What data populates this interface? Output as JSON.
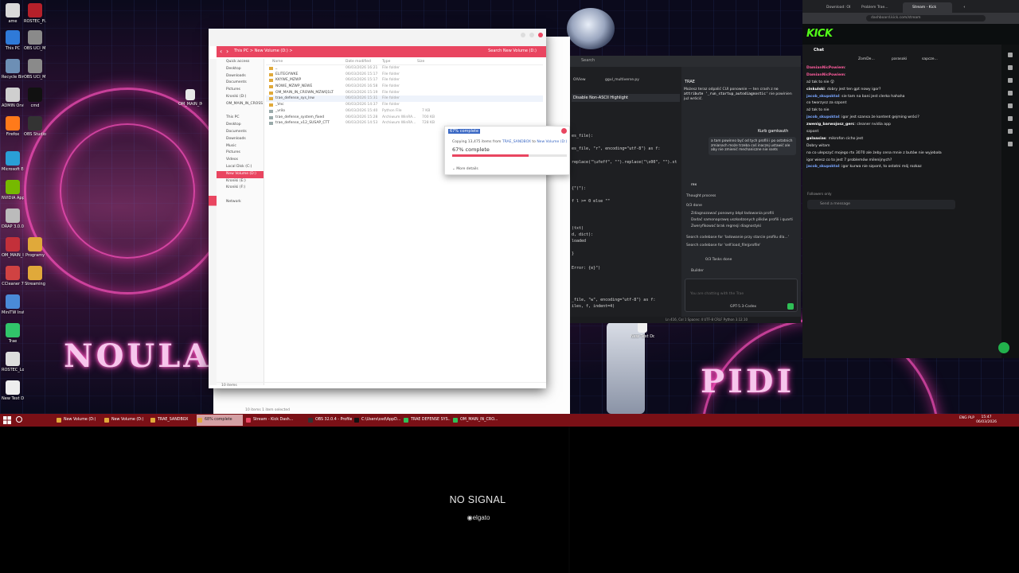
{
  "desktop": {
    "icons": [
      {
        "label": "ame",
        "color": "#d9d9d9"
      },
      {
        "label": "ROSTEC_Fi...",
        "color": "#b5202a"
      },
      {
        "label": "This PC",
        "color": "#2f7ad8"
      },
      {
        "label": "OBS UCI_M...",
        "color": "#8a8a8a"
      },
      {
        "label": "Recycle Bin",
        "color": "#6d8fb5"
      },
      {
        "label": "OBS UCI_M...",
        "color": "#8a8a8a"
      },
      {
        "label": "ADMIN Orville...",
        "color": "#cfcfcf"
      },
      {
        "label": "cmd",
        "color": "#111111"
      },
      {
        "label": "Firefox",
        "color": "#ff7a1a"
      },
      {
        "label": "OBS Studio",
        "color": "#333333"
      },
      {
        "label": "Microsoft Edge",
        "color": "#2a9fd6"
      },
      {
        "label": "NVIDIA App",
        "color": "#76b900"
      },
      {
        "label": "DRAP 3.0.0...",
        "color": "#bbbbbb"
      },
      {
        "label": "OM_MAIN_I...",
        "color": "#c3303a"
      },
      {
        "label": "Programy",
        "color": "#e0a93a"
      },
      {
        "label": "CCleaner 7",
        "color": "#d04242"
      },
      {
        "label": "Streaming",
        "color": "#e0a93a"
      },
      {
        "label": "MiniTW Installer",
        "color": "#4a8ad8"
      },
      {
        "label": "Trae",
        "color": "#31c46a"
      },
      {
        "label": "ROSTEC_Log",
        "color": "#dddddd"
      },
      {
        "label": "New Text Docume...",
        "color": "#eeeeee"
      }
    ],
    "mid_icons": [
      {
        "label": "OM_MAIN_IN..."
      },
      {
        "label": "New Text Docume..."
      }
    ],
    "wallpaper_text": "NOULA PIDI"
  },
  "explorer": {
    "breadcrumb": "This PC  >  New Volume (D:)  >",
    "search_placeholder": "Search New Volume (D:)",
    "sidebar": [
      {
        "label": "Quick access",
        "selected": false
      },
      {
        "label": "Desktop",
        "selected": false
      },
      {
        "label": "Downloads",
        "selected": false
      },
      {
        "label": "Documents",
        "selected": false
      },
      {
        "label": "Pictures",
        "selected": false
      },
      {
        "label": "Kroniki (D:)",
        "selected": false
      },
      {
        "label": "OM_MAIN_IN_CROSS",
        "selected": false
      },
      {
        "label": "",
        "selected": false
      },
      {
        "label": "This PC",
        "selected": false
      },
      {
        "label": "Desktop",
        "selected": false
      },
      {
        "label": "Documents",
        "selected": false
      },
      {
        "label": "Downloads",
        "selected": false
      },
      {
        "label": "Music",
        "selected": false
      },
      {
        "label": "Pictures",
        "selected": false
      },
      {
        "label": "Videos",
        "selected": false
      },
      {
        "label": "Local Disk (C:)",
        "selected": false
      },
      {
        "label": "New Volume (D:)",
        "selected": true
      },
      {
        "label": "Kroniki (E:)",
        "selected": false
      },
      {
        "label": "Kroniki (F:)",
        "selected": false
      },
      {
        "label": "",
        "selected": false
      },
      {
        "label": "Network",
        "selected": false
      }
    ],
    "columns": [
      "Name",
      "Date modified",
      "Type",
      "Size"
    ],
    "rows": [
      {
        "name": "_",
        "date": "06/03/2026 16:21",
        "type": "File folder",
        "size": "",
        "kind": "folder"
      },
      {
        "name": "ELITEGYWKE",
        "date": "06/03/2026 15:17",
        "type": "File folder",
        "size": "",
        "kind": "folder"
      },
      {
        "name": "KKYWE_MZWP",
        "date": "06/03/2026 15:17",
        "type": "File folder",
        "size": "",
        "kind": "folder"
      },
      {
        "name": "NOWE_MZWP_NEWE",
        "date": "06/03/2026 16:58",
        "type": "File folder",
        "size": "",
        "kind": "folder"
      },
      {
        "name": "OM_MAIN_IN_CROWN_MZWQ1LT",
        "date": "06/03/2026 15:19",
        "type": "File folder",
        "size": "",
        "kind": "folder"
      },
      {
        "name": "trae_defense_sys_lnw",
        "date": "06/03/2026 15:31",
        "type": "File folder",
        "size": "",
        "kind": "folder"
      },
      {
        "name": "_Vnc",
        "date": "06/03/2026 14:37",
        "type": "File folder",
        "size": "",
        "kind": "folder"
      },
      {
        "name": "_vrilo",
        "date": "06/03/2026 15:40",
        "type": "Python File",
        "size": "7 KB",
        "kind": "file"
      },
      {
        "name": "trae_defense_system_fixed",
        "date": "06/03/2026 15:28",
        "type": "Archiwum WinRA...",
        "size": "700 KB",
        "kind": "file"
      },
      {
        "name": "trae_defense_v12_SUSAP_CTT",
        "date": "06/03/2026 14:53",
        "type": "Archiwum WinRA...",
        "size": "728 KB",
        "kind": "file"
      }
    ],
    "status": "10 items",
    "status2": "10 items      1 item selected"
  },
  "copy_dialog": {
    "title": "67% complete",
    "description_prefix": "Copying 13,475 items from",
    "source": "TRAE_SANDBOX",
    "description_mid": "to",
    "destination": "New Volume (D:)",
    "percent_text": "67% complete",
    "progress": 0.67,
    "more_details": "More details"
  },
  "ide": {
    "search": "Search",
    "tabs": [
      "OIView",
      "ggul_multiverse.py"
    ],
    "notice": "Disable Non-ASCII Highlight",
    "code_lines": [
      "es_file):",
      "es_file, \"r\", encoding=\"utf-8\") as f:",
      "replace(\"\\ufeff\", \"\").replace(\"\\x00\", \"\").st",
      "{\"(\"):",
      "f l >= 0 else \"\"",
      "(txt)",
      "d, dict):",
      "loaded",
      "}",
      "Error: {e}\")",
      "_file, \"w\", encoding=\"utf-8\") as f:",
      "iles, f, indent=4)"
    ],
    "panel_title": "TRAE",
    "panel_message": "Możesz teraz odpalić CUI ponownie — ten crash z",
    "panel_code": "no attribute '_run_startup_autodiagnostic'",
    "panel_message_end": "nie powinien już wrócić.",
    "chat_user": "Kurb gamkauth",
    "bubble_text": "a tam powinno być od tych profili i po ostatnich zmianach może trzeba coś inaczej ustawić ale aby nie zmienić mechaniczne nie ssets",
    "assistant_label": "rex",
    "thought": "Thought process",
    "todo_count": "0/3 done",
    "todos": [
      "Zdiagnozować ponowny błąd ładowania profili",
      "Dodać samonaprawę uszkodzonych plików profili i quarti",
      "Zweryfikować brak regresji diagnostyki"
    ],
    "search_line_1": "Search codebase for 'ladowanie przy starcie profilu dla...'",
    "search_line_2": "Search codebase for 'self.load_file|profile'",
    "tasks_done": "0/3 Tasks done",
    "builder": "Builder",
    "input_placeholder": "You are chatting with the Trae",
    "model": "GPT-5.3-Codex",
    "statusbar": "Ln 416, Col 1    Spaces: 4    UTF-8    CRLF    Python    3.12.10"
  },
  "browser": {
    "tabs": [
      "Download: OBS",
      "Problem Trae...",
      "Stream - Kick",
      "+"
    ],
    "url": "dashboard.kick.com/stream",
    "logo": "KICK",
    "chat_title": "Chat",
    "pinned": [
      "ZomDe...",
      "parasoki",
      "sapcze..."
    ],
    "messages": [
      {
        "user": "DamianNicPowiem",
        "text": "",
        "color": "#ff5c9e"
      },
      {
        "user": "DamianNicPowiem",
        "text": "",
        "color": "#ff5c9e"
      },
      {
        "user": "",
        "text": "aż tak to nie 😮",
        "color": "#ff5c9e"
      },
      {
        "user": "cinkulski",
        "text": "dobry jest ten gpt nowy igor?",
        "color": "#ffffff"
      },
      {
        "user": "jacob_skupsktal",
        "text": "sie tam na bani jest clerko hahaha",
        "color": "#7aa6ff"
      },
      {
        "user": "",
        "text": "co tworzysz za szpont",
        "color": "#ff5c9e"
      },
      {
        "user": "",
        "text": "aż tak to nie",
        "color": "#ff5c9e"
      },
      {
        "user": "jacob_skupsktal",
        "text": "igor jest szansa że kontent gejming wróci?",
        "color": "#7aa6ff"
      },
      {
        "user": "zwenig_barwojosz_gerc",
        "text": "cleaner nvidia app",
        "color": "#ffffff"
      },
      {
        "user": "",
        "text": "szpont",
        "color": "#ff5c9e"
      },
      {
        "user": "galaaxias",
        "text": "mikrofon cicho jest",
        "color": "#ffffff"
      },
      {
        "user": "",
        "text": "Dobry witam",
        "color": "#ffa84a"
      },
      {
        "user": "",
        "text": "na co ulepszyć mojego rtx 3070 ale żeby cena mnie z butów nie wyjebała",
        "color": "#ff5c9e"
      },
      {
        "user": "",
        "text": "igor wiesz co to jest 7 problemów milenijnych?",
        "color": "#ff5c9e"
      },
      {
        "user": "jacob_skupsktal",
        "text": "igor kurwa nie szpont, to ostatni mój rozkaz",
        "color": "#7aa6ff"
      }
    ],
    "followers_only": "Followers only",
    "send_placeholder": "Send a message"
  },
  "taskbar": {
    "items": [
      {
        "label": "New Volume (D:)",
        "icon_color": "#e0a93a",
        "state": "normal"
      },
      {
        "label": "New Volume (D:)",
        "icon_color": "#e0a93a",
        "state": "normal"
      },
      {
        "label": "TRAE_SANDBOX",
        "icon_color": "#e0a93a",
        "state": "normal"
      },
      {
        "label": "68% complete",
        "icon_color": "#e0a93a",
        "state": "highlight"
      },
      {
        "label": "Stream - Kick Dash...",
        "icon_color": "#e94560",
        "state": "normal"
      },
      {
        "label": "OBS 32.0.4 - Profile:...",
        "icon_color": "#333333",
        "state": "normal"
      },
      {
        "label": "C:\\Users\\osd\\AppD...",
        "icon_color": "#111111",
        "state": "normal"
      },
      {
        "label": "TRAE DEFENSE SYS...",
        "icon_color": "#2fbf56",
        "state": "normal"
      },
      {
        "label": "OM_MAIN_IN_CRO...",
        "icon_color": "#2fbf56",
        "state": "normal"
      }
    ],
    "tray": "ENG PLP",
    "time": "15:47",
    "date": "06/03/2026"
  },
  "no_signal": {
    "text": "NO SIGNAL",
    "brand": "elgato"
  },
  "colors": {
    "accent": "#e94560",
    "taskbar": "#7a1016",
    "kick_green": "#53fc18"
  }
}
